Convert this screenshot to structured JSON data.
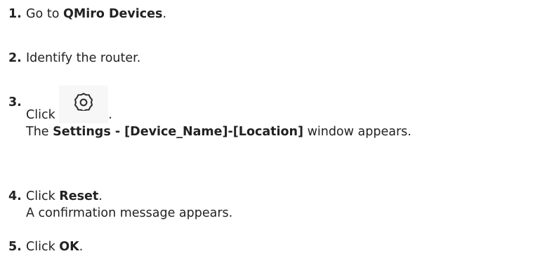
{
  "steps": [
    {
      "number": "1.",
      "pre": "Go to ",
      "bold": "QMiro Devices",
      "post": "."
    },
    {
      "number": "2.",
      "text": "Identify the router."
    },
    {
      "number": "3.",
      "pre": "Click ",
      "icon": "settings-gear-icon",
      "post": ".",
      "result_pre": "The ",
      "result_bold": "Settings - [Device_Name]-[Location]",
      "result_post": " window appears."
    },
    {
      "number": "4.",
      "pre": "Click ",
      "bold": "Reset",
      "post": ".",
      "result": "A confirmation message appears."
    },
    {
      "number": "5.",
      "pre": "Click ",
      "bold": "OK",
      "post": "."
    }
  ]
}
